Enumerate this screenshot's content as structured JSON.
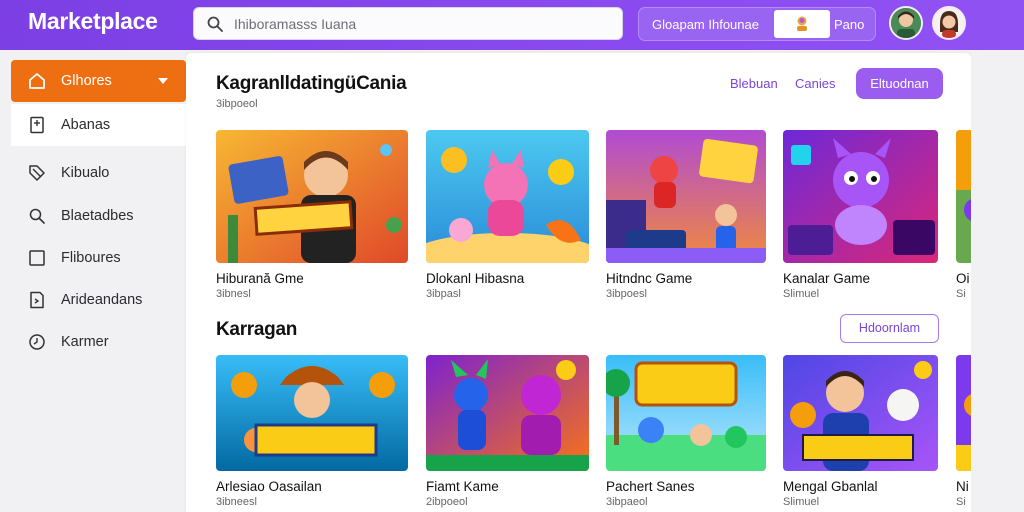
{
  "app": {
    "logo": "Marketplace"
  },
  "search": {
    "placeholder": "Ihiboramasss Iuana"
  },
  "header_cta": {
    "label": "Gloapam Ihfounae",
    "end_label": "Pano"
  },
  "colors": {
    "brand_purple": "#8a4af0",
    "active_orange": "#ee6f12"
  },
  "sidebar": {
    "items": [
      {
        "label": "Glhores",
        "icon": "home-icon",
        "active": true
      },
      {
        "label": "Abanas",
        "icon": "document-icon"
      },
      {
        "label": "Kibualo",
        "icon": "tag-icon"
      },
      {
        "label": "Blaetadbes",
        "icon": "search-icon"
      },
      {
        "label": "Fliboures",
        "icon": "square-icon"
      },
      {
        "label": "Arideandans",
        "icon": "file-icon"
      },
      {
        "label": "Karmer",
        "icon": "clock-icon"
      }
    ]
  },
  "section1": {
    "title": "KagranlldatingüCania",
    "subtitle": "3ibpoeol",
    "link1": "Blebuan",
    "link2": "Canies",
    "button": "Eltuodnan",
    "cards": [
      {
        "title": "Hiburană Gme",
        "subtitle": "3ibnesl"
      },
      {
        "title": "Dlokanl Hibasna",
        "subtitle": "3ibpasl"
      },
      {
        "title": "Hitndnc Game",
        "subtitle": "3ibpoesl"
      },
      {
        "title": "Kanalar Game",
        "subtitle": "Slimuel"
      },
      {
        "title": "Oi",
        "subtitle": "Si"
      }
    ]
  },
  "section2": {
    "title": "Karragan",
    "button": "Hdoornlam",
    "cards": [
      {
        "title": "Arlesiao Oasailan",
        "subtitle": "3ibneesl"
      },
      {
        "title": "Fiamt Kame",
        "subtitle": "2ibpoeol"
      },
      {
        "title": "Pachert Sanes",
        "subtitle": "3ibpaeol"
      },
      {
        "title": "Mengal Gbanlal",
        "subtitle": "Slimuel"
      },
      {
        "title": "Ni",
        "subtitle": "Si"
      }
    ]
  }
}
